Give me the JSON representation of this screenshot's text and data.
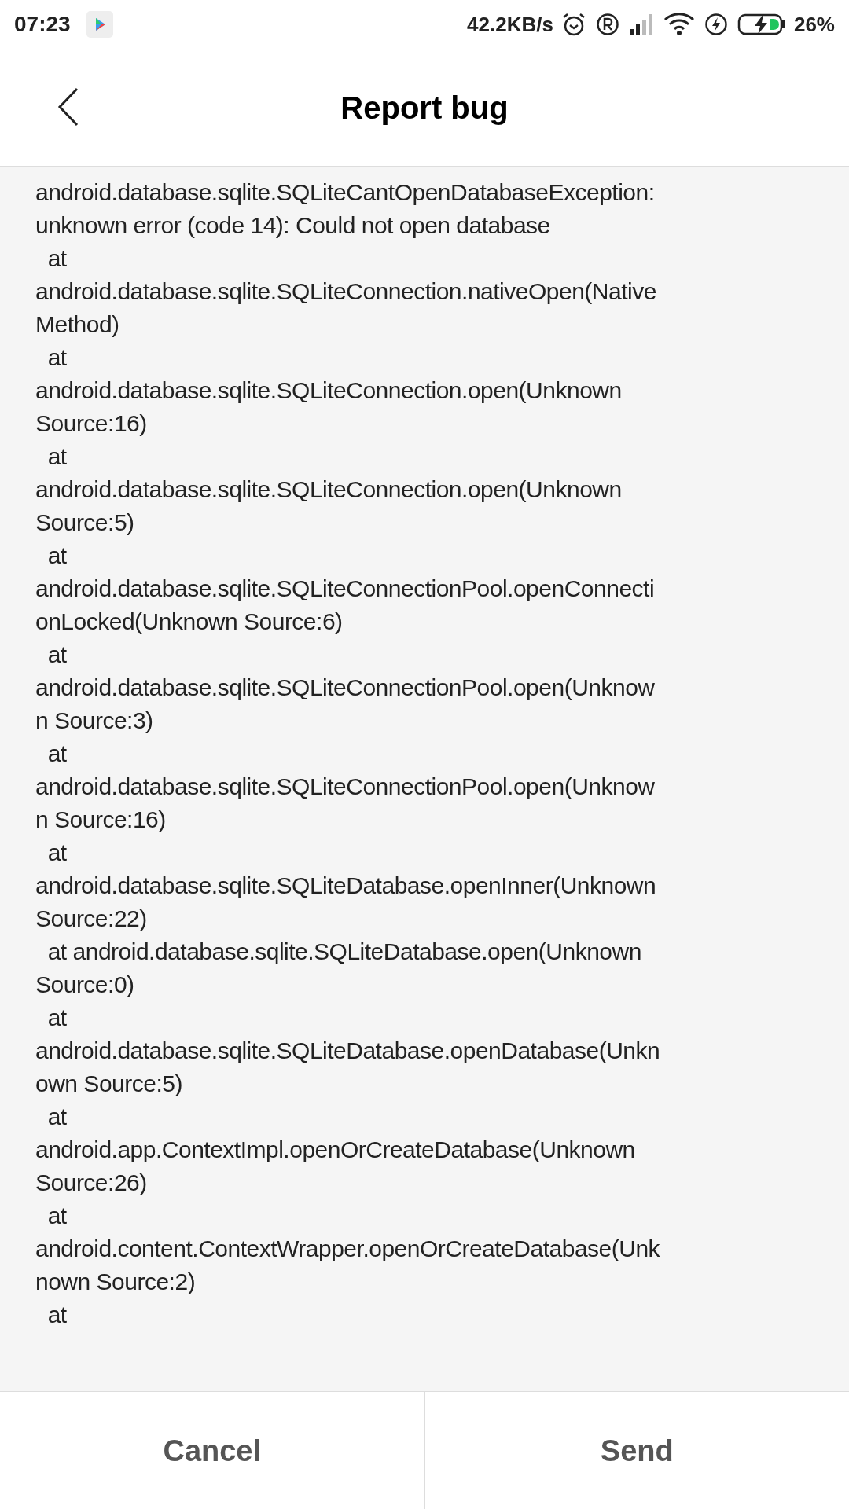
{
  "status_bar": {
    "time": "07:23",
    "speed": "42.2KB/s",
    "battery": "26%"
  },
  "header": {
    "title": "Report bug"
  },
  "log_lines": [
    "android.database.sqlite.SQLiteCantOpenDatabaseException:",
    "unknown error (code 14): Could not open database",
    "  at",
    "android.database.sqlite.SQLiteConnection.nativeOpen(Native",
    "Method)",
    "  at",
    "android.database.sqlite.SQLiteConnection.open(Unknown",
    "Source:16)",
    "  at",
    "android.database.sqlite.SQLiteConnection.open(Unknown",
    "Source:5)",
    "  at",
    "android.database.sqlite.SQLiteConnectionPool.openConnecti",
    "onLocked(Unknown Source:6)",
    "  at",
    "android.database.sqlite.SQLiteConnectionPool.open(Unknow",
    "n Source:3)",
    "  at",
    "android.database.sqlite.SQLiteConnectionPool.open(Unknow",
    "n Source:16)",
    "  at",
    "android.database.sqlite.SQLiteDatabase.openInner(Unknown",
    "Source:22)",
    "  at android.database.sqlite.SQLiteDatabase.open(Unknown",
    "Source:0)",
    "  at",
    "android.database.sqlite.SQLiteDatabase.openDatabase(Unkn",
    "own Source:5)",
    "  at",
    "android.app.ContextImpl.openOrCreateDatabase(Unknown",
    "Source:26)",
    "  at",
    "android.content.ContextWrapper.openOrCreateDatabase(Unk",
    "nown Source:2)",
    "  at"
  ],
  "buttons": [
    {
      "label": "Cancel"
    },
    {
      "label": "Send"
    }
  ]
}
